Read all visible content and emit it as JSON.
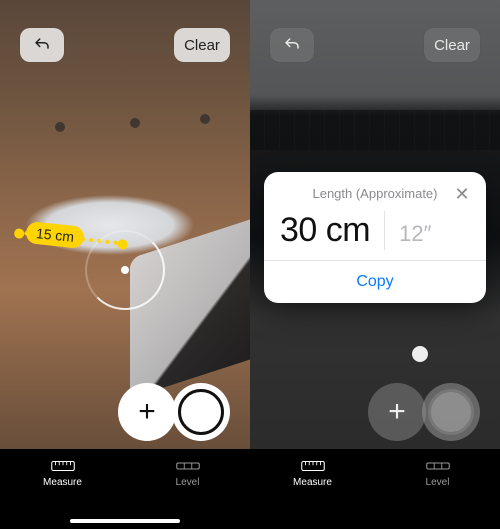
{
  "left": {
    "undo_label": "Undo",
    "clear_label": "Clear",
    "measurement_label": "15 cm",
    "add_label": "Add point",
    "shutter_label": "Capture",
    "tabs": {
      "measure": "Measure",
      "level": "Level"
    }
  },
  "right": {
    "undo_label": "Undo",
    "clear_label": "Clear",
    "add_label": "Add point",
    "shutter_label": "Capture",
    "tabs": {
      "measure": "Measure",
      "level": "Level"
    },
    "result": {
      "title": "Length (Approximate)",
      "primary": "30 cm",
      "secondary": "12″",
      "copy_label": "Copy",
      "close_label": "Close"
    }
  },
  "colors": {
    "accent": "#0a7aff",
    "measure_tag": "#ffd400"
  }
}
